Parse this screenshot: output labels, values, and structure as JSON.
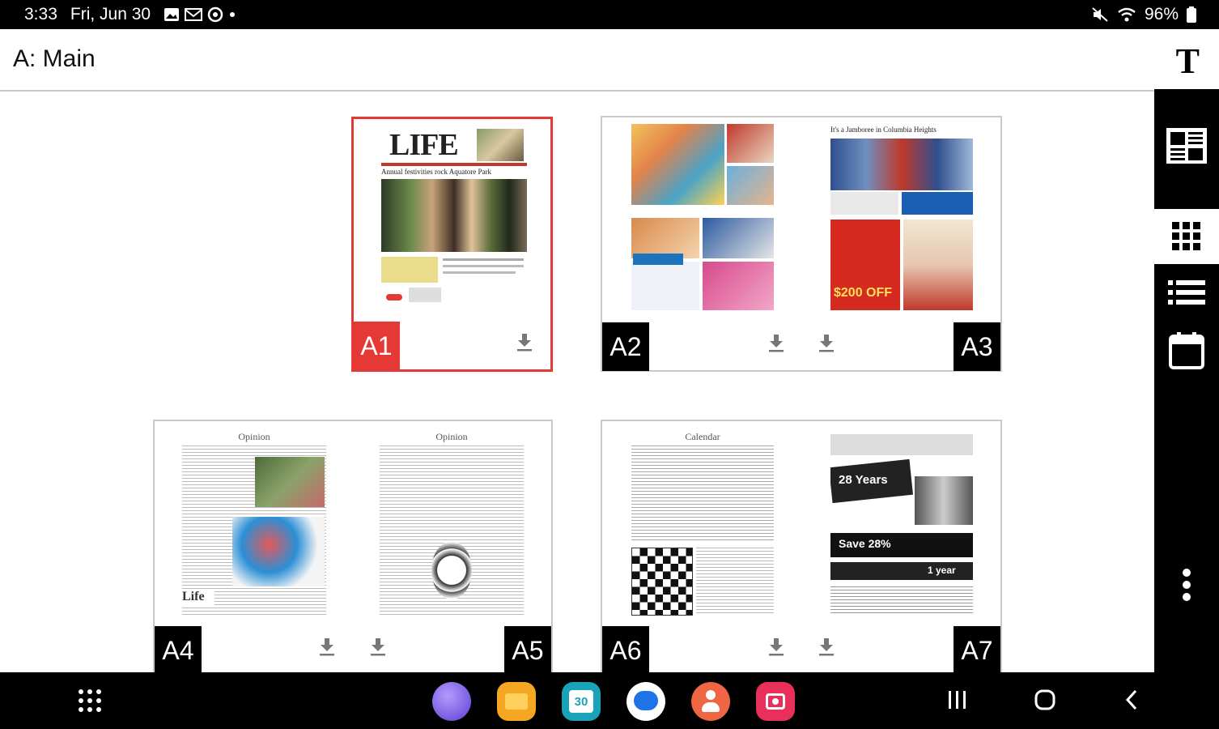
{
  "status_bar": {
    "time": "3:33",
    "date": "Fri, Jun 30",
    "battery": "96%",
    "icons": [
      "gallery-icon",
      "gmail-icon",
      "sync-icon",
      "dot-icon",
      "mute-icon",
      "wifi-icon",
      "battery-icon"
    ]
  },
  "app_bar": {
    "title": "A: Main",
    "text_size_label": "T"
  },
  "right_rail": {
    "items": [
      "page-layout-icon",
      "grid-view-icon",
      "list-view-icon",
      "calendar-icon",
      "more-vert-icon"
    ]
  },
  "pages": {
    "a1": {
      "label": "A1",
      "masthead": "LIFE",
      "headline": "Annual festivities rock Aquatore Park",
      "selected": true
    },
    "a2": {
      "label": "A2"
    },
    "a3": {
      "label": "A3",
      "headline": "It's a Jamboree in Columbia Heights",
      "promo": "$200 OFF"
    },
    "a4": {
      "label": "A4",
      "section": "Opinion"
    },
    "a5": {
      "label": "A5",
      "section": "Opinion"
    },
    "a6": {
      "label": "A6",
      "section": "Calendar"
    },
    "a7": {
      "label": "A7",
      "promo": "28 Years",
      "promo2": "Save 28%",
      "promo3": "1 year"
    }
  },
  "taskbar": {
    "apps": [
      "app-drawer-icon",
      "samsung-internet-icon",
      "my-files-icon",
      "calendar-app-icon",
      "messages-icon",
      "contacts-icon",
      "screen-recorder-icon"
    ],
    "calendar_day": "30",
    "nav": [
      "recents-icon",
      "home-icon",
      "back-icon"
    ]
  },
  "colors": {
    "accent": "#e53935",
    "bar": "#000000"
  }
}
